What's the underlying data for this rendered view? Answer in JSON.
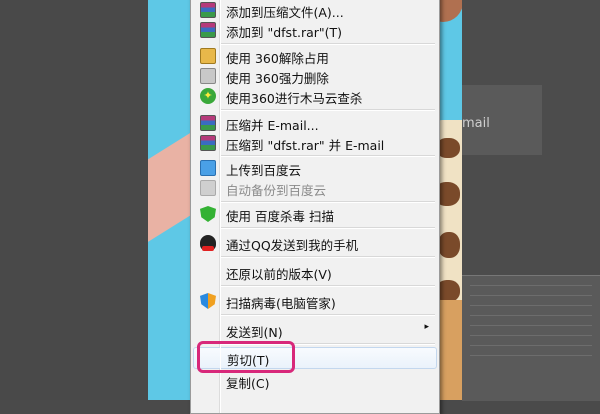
{
  "background": {
    "doc_text": "mail"
  },
  "context_menu": {
    "items": [
      {
        "label": "添加到压缩文件(A)...",
        "icon": "winrar-icon"
      },
      {
        "label": "添加到 \"dfst.rar\"(T)",
        "icon": "winrar-icon"
      },
      {
        "label": "使用 360解除占用",
        "icon": "360-unlock-icon"
      },
      {
        "label": "使用 360强力删除",
        "icon": "360-delete-icon"
      },
      {
        "label": "使用360进行木马云查杀",
        "icon": "360-scan-icon"
      },
      {
        "label": "压缩并 E-mail...",
        "icon": "winrar-icon"
      },
      {
        "label": "压缩到 \"dfst.rar\" 并 E-mail",
        "icon": "winrar-icon"
      },
      {
        "label": "上传到百度云",
        "icon": "baidu-cloud-icon"
      },
      {
        "label": "自动备份到百度云",
        "icon": "baidu-cloud-icon",
        "disabled": true
      },
      {
        "label": "使用 百度杀毒 扫描",
        "icon": "baidu-antivirus-icon"
      },
      {
        "label": "通过QQ发送到我的手机",
        "icon": "qq-icon"
      },
      {
        "label": "还原以前的版本(V)",
        "icon": ""
      },
      {
        "label": "扫描病毒(电脑管家)",
        "icon": "tencent-manager-icon"
      },
      {
        "label": "发送到(N)",
        "icon": "",
        "submenu": true
      },
      {
        "label": "剪切(T)",
        "icon": "",
        "highlighted": true
      },
      {
        "label": "复制(C)",
        "icon": ""
      }
    ],
    "submenu_arrow": "▸"
  },
  "colors": {
    "highlight_box": "#d8287a",
    "menu_bg": "#f1f1f1",
    "hover_border": "#c3d7ee"
  }
}
